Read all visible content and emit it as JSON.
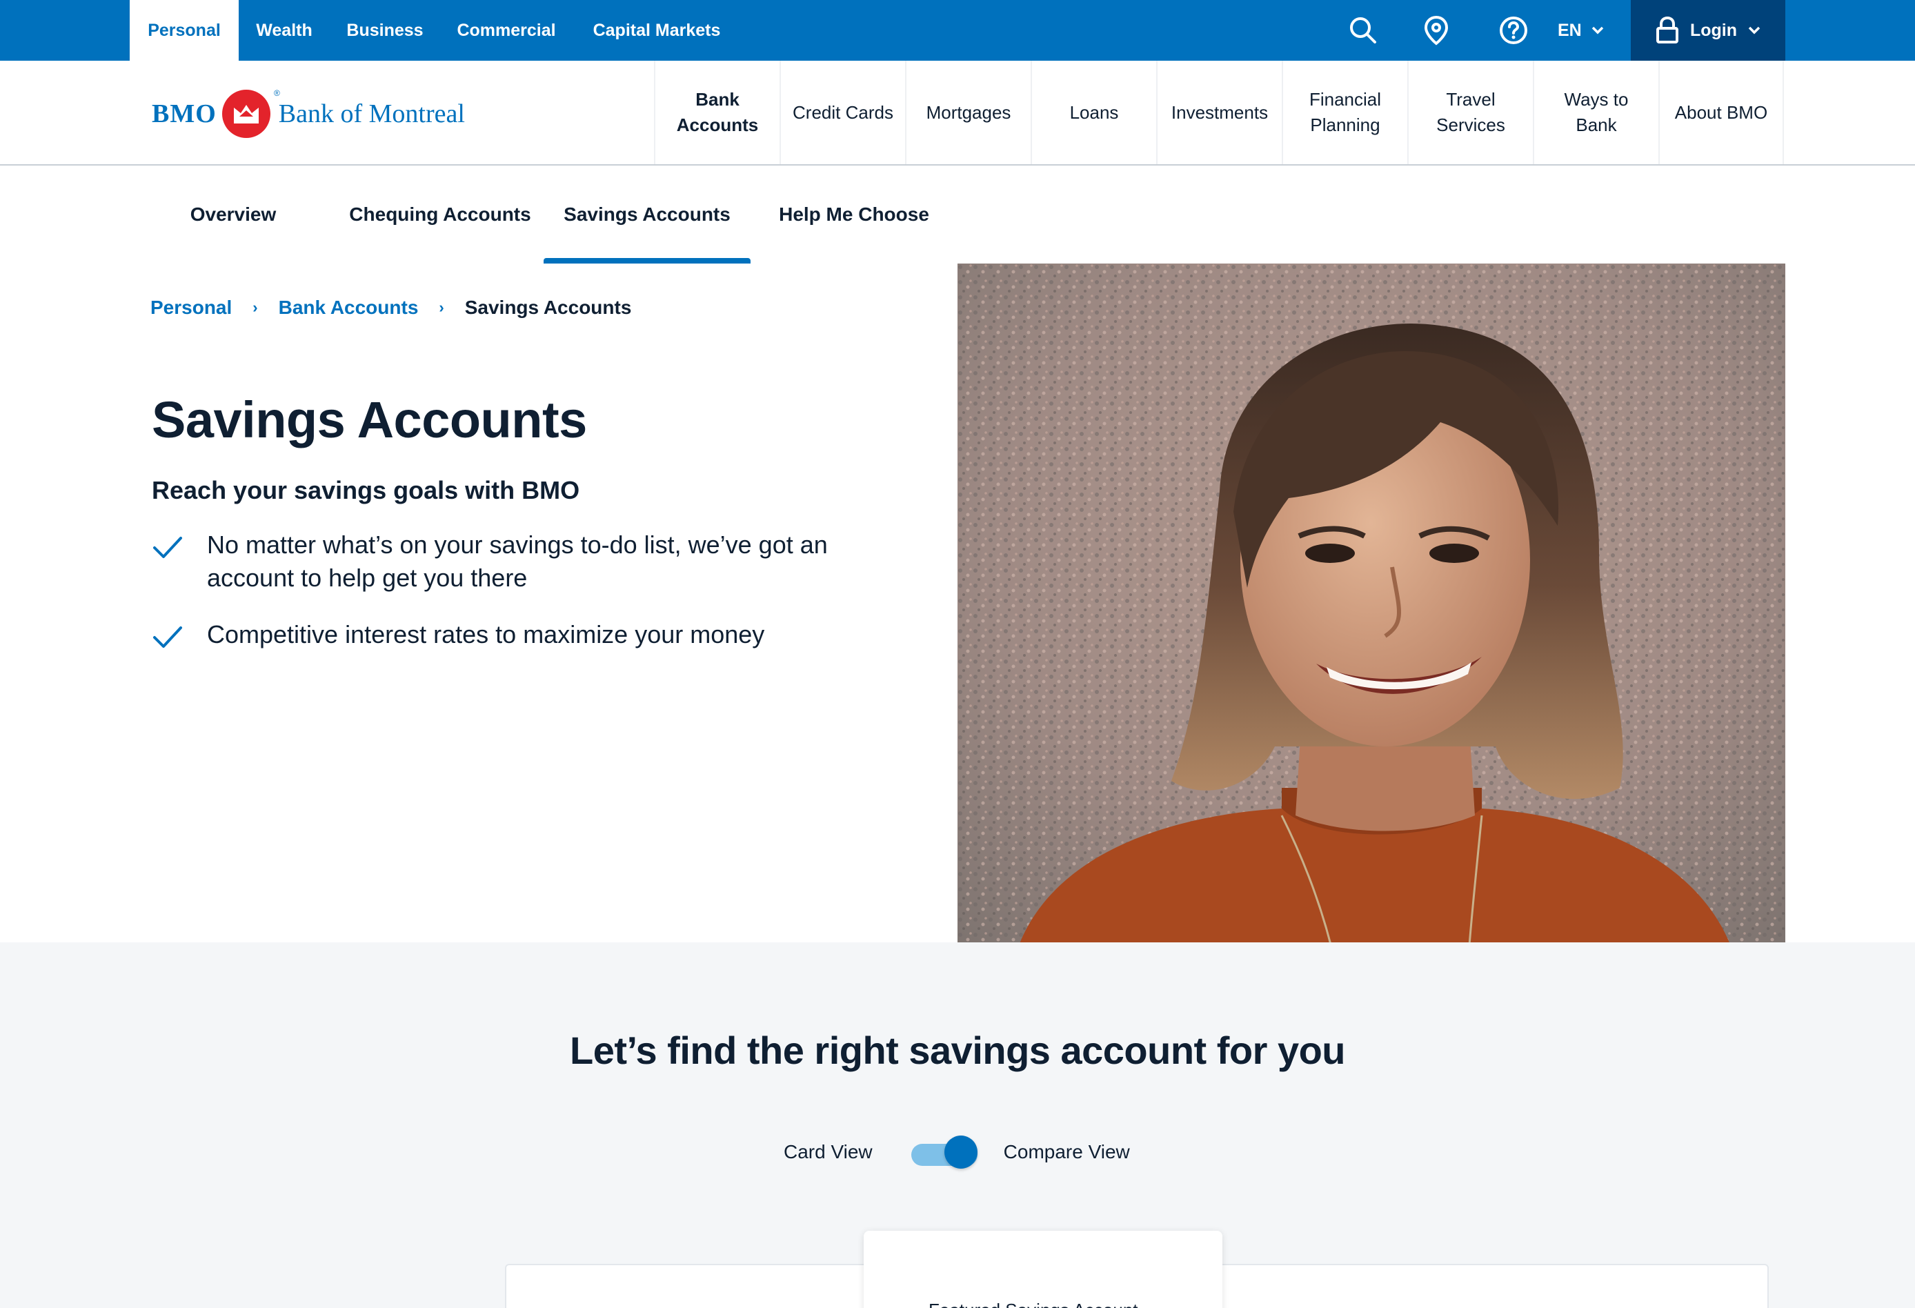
{
  "colors": {
    "brand_blue": "#0071bd",
    "brand_dark_blue": "#00427a",
    "brand_red": "#e3232b",
    "text_dark": "#0f1f32",
    "section_grey": "#f4f6f8"
  },
  "topbar": {
    "segments": [
      "Personal",
      "Wealth",
      "Business",
      "Commercial",
      "Capital Markets"
    ],
    "icons": [
      "search-icon",
      "location-icon",
      "help-icon"
    ],
    "language": "EN",
    "login": "Login"
  },
  "logo": {
    "bmo": "BMO",
    "name": "Bank of Montreal",
    "registered": "®"
  },
  "mainnav": {
    "items": [
      {
        "line1": "Bank",
        "line2": "Accounts"
      },
      {
        "line1": "Credit Cards",
        "line2": ""
      },
      {
        "line1": "Mortgages",
        "line2": ""
      },
      {
        "line1": "Loans",
        "line2": ""
      },
      {
        "line1": "Investments",
        "line2": ""
      },
      {
        "line1": "Financial",
        "line2": "Planning"
      },
      {
        "line1": "Travel",
        "line2": "Services"
      },
      {
        "line1": "Ways to",
        "line2": "Bank"
      },
      {
        "line1": "About BMO",
        "line2": ""
      }
    ]
  },
  "subnav": {
    "items": [
      "Overview",
      "Chequing Accounts",
      "Savings Accounts",
      "Help Me Choose"
    ],
    "active": "Savings Accounts"
  },
  "breadcrumb": {
    "items": [
      "Personal",
      "Bank Accounts",
      "Savings Accounts"
    ],
    "separator": "›"
  },
  "hero": {
    "title": "Savings Accounts",
    "subtitle": "Reach your savings goals with BMO",
    "bullets": [
      "No matter what’s on your savings to-do list, we’ve got an account to help get you there",
      "Competitive interest rates to maximize your money"
    ]
  },
  "finder": {
    "title": "Let’s find the right savings account for you",
    "card_view_label": "Card View",
    "compare_view_label": "Compare View",
    "toggle_on": true,
    "featured_label": "Featured Savings Account"
  }
}
